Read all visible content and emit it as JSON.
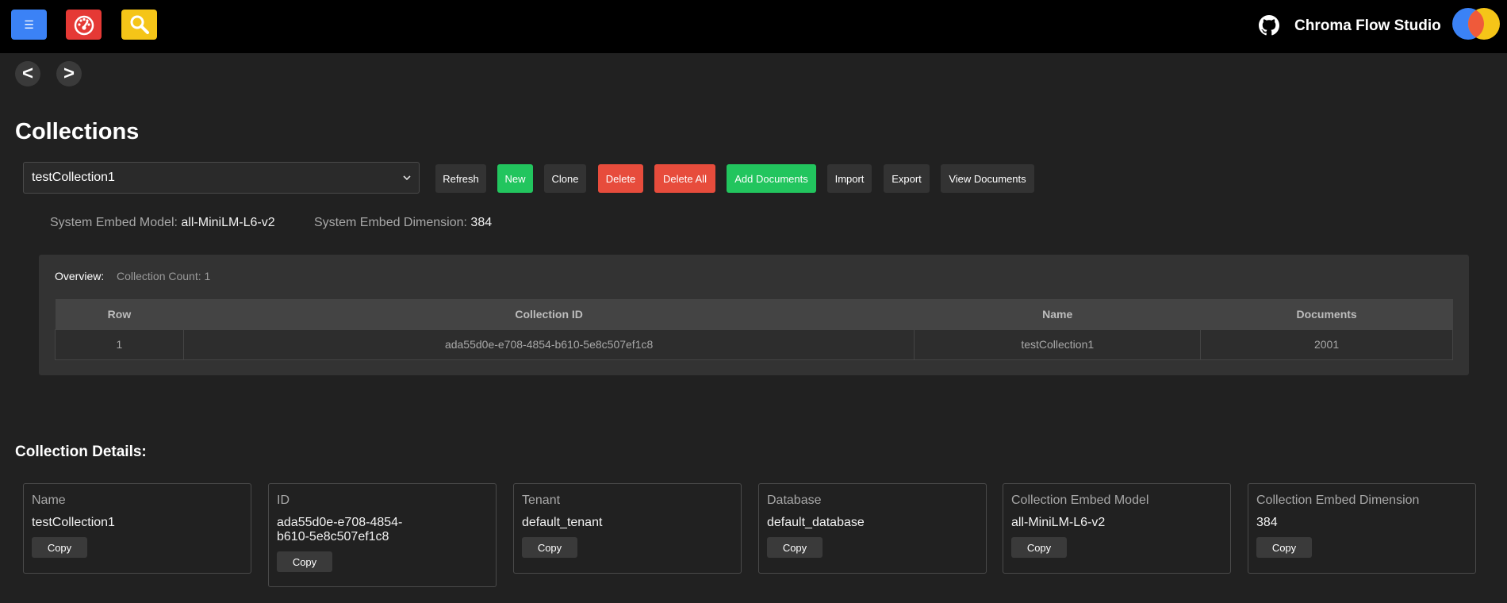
{
  "header": {
    "menu_icon": "☰",
    "app_title": "Chroma Flow Studio",
    "icons": [
      "menu-icon",
      "dashboard-icon",
      "search-icon",
      "github-icon",
      "chroma-logo"
    ]
  },
  "nav": {
    "back": "<",
    "forward": ">"
  },
  "page": {
    "title": "Collections"
  },
  "toolbar": {
    "selected_collection": "testCollection1",
    "refresh": "Refresh",
    "new": "New",
    "clone": "Clone",
    "delete": "Delete",
    "delete_all": "Delete All",
    "add_documents": "Add Documents",
    "import": "Import",
    "export": "Export",
    "view_documents": "View Documents"
  },
  "system": {
    "embed_model_label": "System Embed Model:",
    "embed_model": "all-MiniLM-L6-v2",
    "embed_dimension_label": "System Embed Dimension:",
    "embed_dimension": "384"
  },
  "overview": {
    "label": "Overview:",
    "count_text": "Collection Count: 1",
    "columns": [
      "Row",
      "Collection ID",
      "Name",
      "Documents"
    ],
    "rows": [
      [
        "1",
        "ada55d0e-e708-4854-b610-5e8c507ef1c8",
        "testCollection1",
        "2001"
      ]
    ]
  },
  "details": {
    "title": "Collection Details:",
    "copy_label": "Copy",
    "cards": [
      {
        "label": "Name",
        "value": "testCollection1"
      },
      {
        "label": "ID",
        "value": "ada55d0e-e708-4854-b610-5e8c507ef1c8"
      },
      {
        "label": "Tenant",
        "value": "default_tenant"
      },
      {
        "label": "Database",
        "value": "default_database"
      },
      {
        "label": "Collection Embed Model",
        "value": "all-MiniLM-L6-v2"
      },
      {
        "label": "Collection Embed Dimension",
        "value": "384"
      }
    ]
  },
  "colors": {
    "accent_blue": "#3b82f6",
    "accent_green": "#22c55e",
    "accent_red": "#e74c3c",
    "accent_yellow": "#f5c518"
  }
}
